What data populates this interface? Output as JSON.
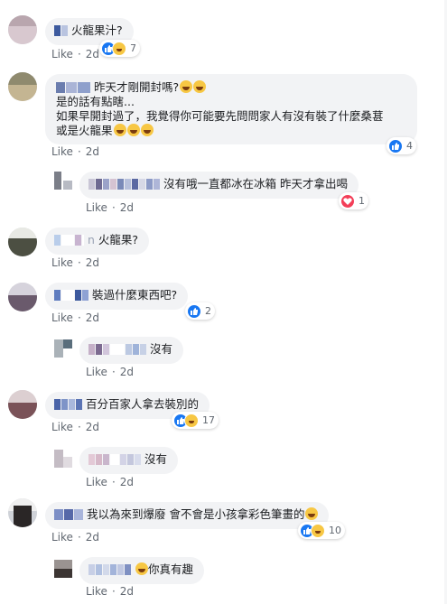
{
  "comments": [
    {
      "text": "火龍果汁?",
      "meta": {
        "like": "Like",
        "sep": "·",
        "time": "2d"
      },
      "reactions": {
        "count": "7"
      }
    },
    {
      "text1": "昨天才剛開封嗎?",
      "text2": "是的話有點瞎...",
      "text3": "如果早開封過了，我覺得你可能要先問問家人有沒有裝了什麼桑葚",
      "text4": "或是火龍果",
      "meta": {
        "like": "Like",
        "sep": "·",
        "time": "2d"
      },
      "reactions": {
        "count": "4"
      }
    },
    {
      "text": "沒有哦一直都冰在冰箱 昨天才拿出喝",
      "meta": {
        "like": "Like",
        "sep": "·",
        "time": "2d"
      },
      "reactions": {
        "count": "1"
      }
    },
    {
      "text": "火龍果?",
      "blurLetter": "n",
      "meta": {
        "like": "Like",
        "sep": "·",
        "time": "2d"
      }
    },
    {
      "text": "裝過什麼東西吧?",
      "meta": {
        "like": "Like",
        "sep": "·",
        "time": "2d"
      },
      "reactions": {
        "count": "2"
      }
    },
    {
      "text": "沒有",
      "meta": {
        "like": "Like",
        "sep": "·",
        "time": "2d"
      }
    },
    {
      "text": "百分百家人拿去裝別的",
      "meta": {
        "like": "Like",
        "sep": "·",
        "time": "2d"
      },
      "reactions": {
        "count": "17"
      }
    },
    {
      "text": "沒有",
      "meta": {
        "like": "Like",
        "sep": "·",
        "time": "2d"
      }
    },
    {
      "text": "我以為來到爆廢 會不會是小孩拿彩色筆畫的",
      "meta": {
        "like": "Like",
        "sep": "·",
        "time": "2d"
      },
      "reactions": {
        "count": "10"
      }
    },
    {
      "text": "你真有趣",
      "meta": {
        "like": "Like",
        "sep": "·",
        "time": "2d"
      }
    }
  ],
  "colors": {
    "like": "#1877f2",
    "haha": "#f7c744",
    "heart": "#f33e58",
    "bubble": "#f2f3f5"
  }
}
